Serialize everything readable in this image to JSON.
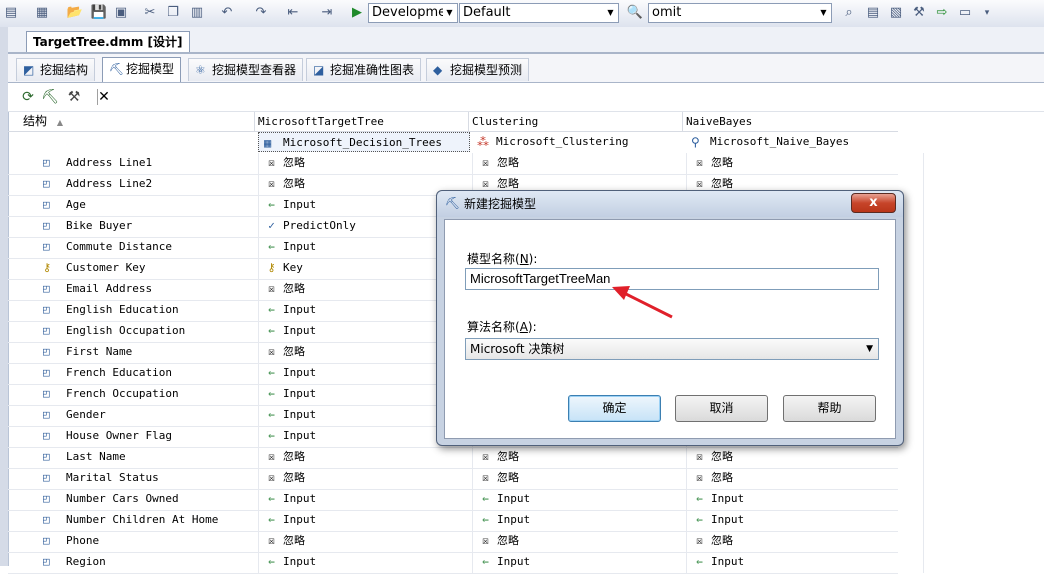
{
  "toolbar": {
    "solution_config": "Developmer",
    "platform": "Default",
    "find_text": "omit"
  },
  "document_tab": {
    "label": "TargetTree.dmm [设计]"
  },
  "designer_tabs": [
    {
      "label": "挖掘结构",
      "icon": "structure-icon"
    },
    {
      "label": "挖掘模型",
      "icon": "mining-model-icon",
      "active": true
    },
    {
      "label": "挖掘模型查看器",
      "icon": "viewer-icon"
    },
    {
      "label": "挖掘准确性图表",
      "icon": "accuracy-chart-icon"
    },
    {
      "label": "挖掘模型预测",
      "icon": "prediction-icon"
    }
  ],
  "grid": {
    "structure_header": "结构",
    "models": [
      {
        "name": "MicrosoftTargetTree",
        "algorithm": "Microsoft_Decision_Trees"
      },
      {
        "name": "Clustering",
        "algorithm": "Microsoft_Clustering"
      },
      {
        "name": "NaiveBayes",
        "algorithm": "Microsoft_Naive_Bayes"
      }
    ],
    "rows": [
      {
        "name": "Address Line1",
        "usage": [
          "忽略",
          "忽略",
          "忽略"
        ]
      },
      {
        "name": "Address Line2",
        "usage": [
          "忽略",
          "忽略",
          "忽略"
        ]
      },
      {
        "name": "Age",
        "usage": [
          "Input",
          "",
          ""
        ]
      },
      {
        "name": "Bike Buyer",
        "usage": [
          "PredictOnly",
          "",
          ""
        ]
      },
      {
        "name": "Commute Distance",
        "usage": [
          "Input",
          "",
          ""
        ]
      },
      {
        "name": "Customer Key",
        "usage": [
          "Key",
          "",
          ""
        ]
      },
      {
        "name": "Email Address",
        "usage": [
          "忽略",
          "",
          ""
        ]
      },
      {
        "name": "English Education",
        "usage": [
          "Input",
          "",
          ""
        ]
      },
      {
        "name": "English Occupation",
        "usage": [
          "Input",
          "",
          ""
        ]
      },
      {
        "name": "First Name",
        "usage": [
          "忽略",
          "",
          ""
        ]
      },
      {
        "name": "French Education",
        "usage": [
          "Input",
          "",
          ""
        ]
      },
      {
        "name": "French Occupation",
        "usage": [
          "Input",
          "",
          ""
        ]
      },
      {
        "name": "Gender",
        "usage": [
          "Input",
          "",
          ""
        ]
      },
      {
        "name": "House Owner Flag",
        "usage": [
          "Input",
          "",
          ""
        ]
      },
      {
        "name": "Last Name",
        "usage": [
          "忽略",
          "忽略",
          "忽略"
        ]
      },
      {
        "name": "Marital Status",
        "usage": [
          "忽略",
          "忽略",
          "忽略"
        ]
      },
      {
        "name": "Number Cars Owned",
        "usage": [
          "Input",
          "Input",
          "Input"
        ]
      },
      {
        "name": "Number Children At Home",
        "usage": [
          "Input",
          "Input",
          "Input"
        ]
      },
      {
        "name": "Phone",
        "usage": [
          "忽略",
          "忽略",
          "忽略"
        ]
      },
      {
        "name": "Region",
        "usage": [
          "Input",
          "Input",
          "Input"
        ]
      }
    ]
  },
  "dialog": {
    "title": "新建挖掘模型",
    "close_label": "x",
    "model_name_label": "模型名称(",
    "model_name_key": "N",
    "model_name_label_end": "):",
    "model_name_value": "MicrosoftTargetTreeMan",
    "algorithm_label": "算法名称(",
    "algorithm_key": "A",
    "algorithm_label_end": "):",
    "algorithm_value": "Microsoft 决策树",
    "ok_label": "确定",
    "cancel_label": "取消",
    "help_label": "帮助"
  },
  "colors": {
    "annotation_arrow": "#e0202a",
    "close_button": "#c7452a"
  }
}
